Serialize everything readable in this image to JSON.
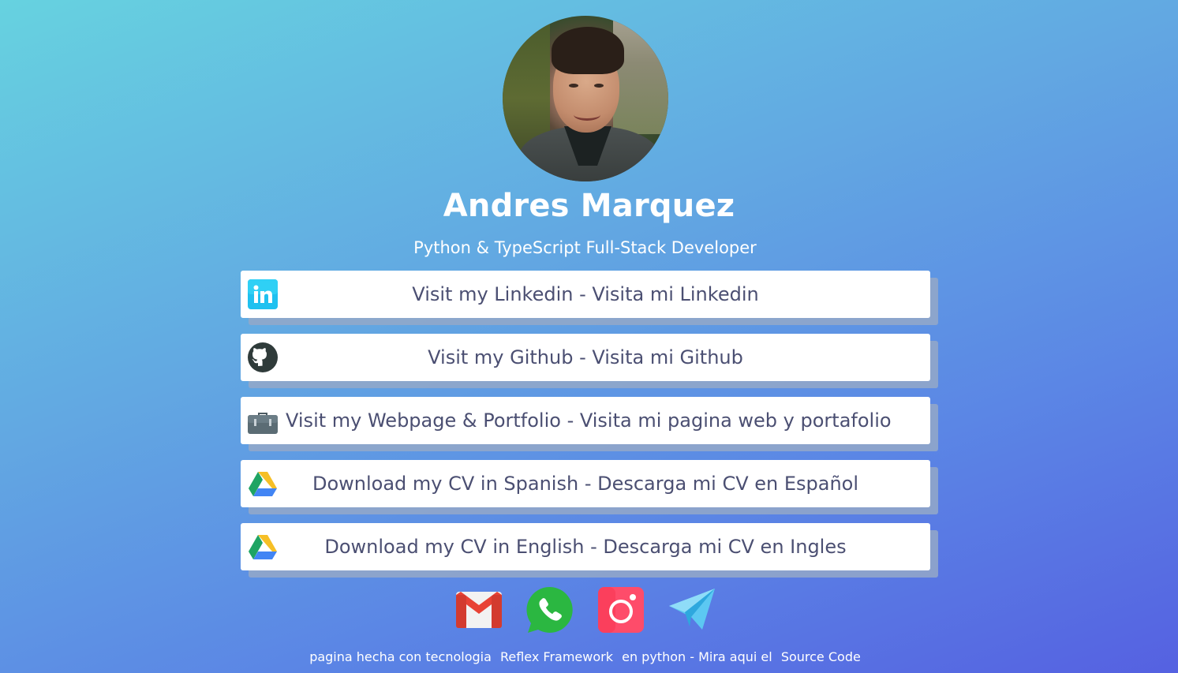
{
  "profile": {
    "name": "Andres Marquez",
    "subtitle": "Python & TypeScript Full-Stack Developer",
    "avatar_icon": "profile-photo"
  },
  "links": [
    {
      "label": "Visit my Linkedin - Visita mi Linkedin",
      "icon": "linkedin-icon"
    },
    {
      "label": "Visit my Github - Visita mi Github",
      "icon": "github-icon"
    },
    {
      "label": "Visit my Webpage & Portfolio - Visita mi pagina web y portafolio",
      "icon": "briefcase-icon"
    },
    {
      "label": "Download my CV in Spanish - Descarga mi CV en Español",
      "icon": "google-drive-icon"
    },
    {
      "label": "Download my CV in English - Descarga mi CV en Ingles",
      "icon": "google-drive-icon"
    }
  ],
  "social": [
    {
      "icon": "gmail-icon"
    },
    {
      "icon": "whatsapp-icon"
    },
    {
      "icon": "instagram-icon"
    },
    {
      "icon": "telegram-icon"
    }
  ],
  "footer": {
    "text1": "pagina hecha con tecnologia",
    "link1": "Reflex Framework",
    "text2": "en python - Mira aqui el",
    "link2": "Source Code"
  },
  "colors": {
    "gradient_start": "#66d2e0",
    "gradient_end": "#5561e1",
    "card_text": "#4b4f72",
    "card_shadow": "#94a8c8"
  }
}
